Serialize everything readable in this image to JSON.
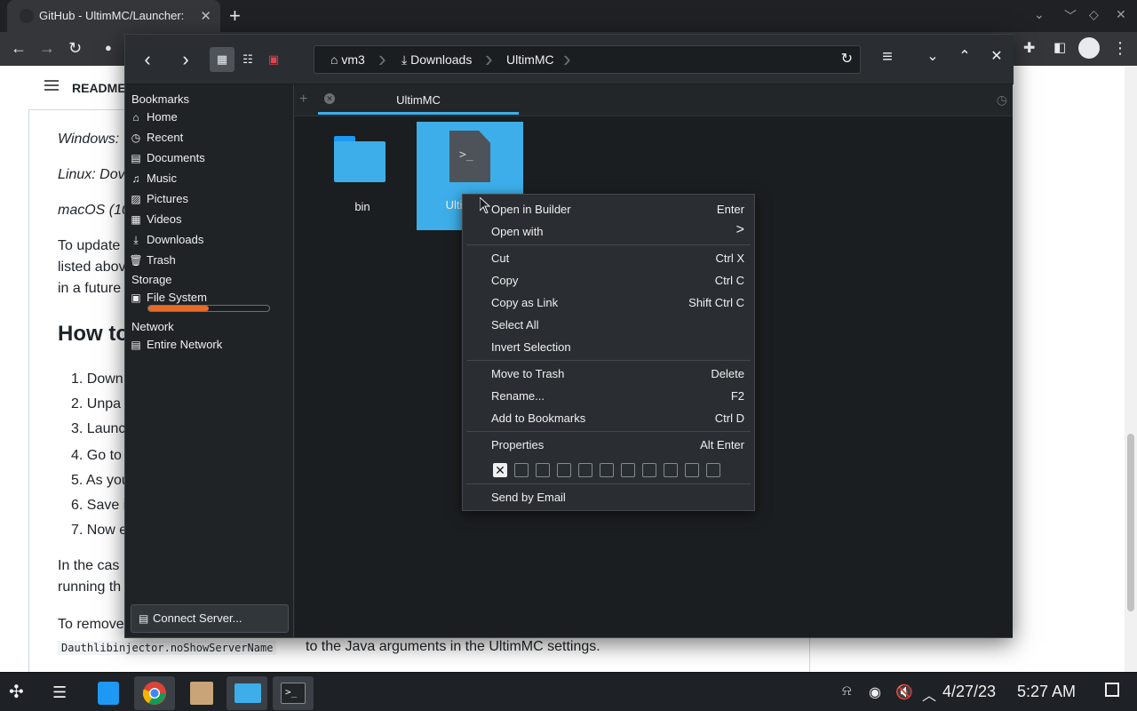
{
  "browser": {
    "tab_title": "GitHub - UltimMC/Launcher:",
    "tab_close": "✕",
    "new_tab": "+",
    "readme_label": "README"
  },
  "page_text": {
    "windows": "Windows:",
    "linux": "Linux: Dov",
    "macos": "macOS (10",
    "update_1": "To update",
    "update_2": "listed abov",
    "update_3": "in a future",
    "heading": "How to",
    "steps": [
      "1. Down",
      "2. Unpa",
      "3. Launc",
      "4. Go to",
      "5. As you",
      "6. Save i",
      "7. Now e"
    ],
    "case_1": "In the cas",
    "case_2": "running th",
    "remove": "To remove",
    "code": "Dauthlibinjector.noShowServerName",
    "tail": " to the Java arguments in the UltimMC settings."
  },
  "dolphin": {
    "breadcrumb": [
      {
        "label": "vm3",
        "icon": "home-icon"
      },
      {
        "label": "Downloads",
        "icon": "download-icon"
      },
      {
        "label": "UltimMC",
        "icon": ""
      }
    ],
    "places": {
      "bookmarks_header": "Bookmarks",
      "bookmarks": [
        {
          "label": "Home",
          "icon": "⌂"
        },
        {
          "label": "Recent",
          "icon": "◷"
        },
        {
          "label": "Documents",
          "icon": "▤"
        },
        {
          "label": "Music",
          "icon": "♫"
        },
        {
          "label": "Pictures",
          "icon": "▨"
        },
        {
          "label": "Videos",
          "icon": "▦"
        },
        {
          "label": "Downloads",
          "icon": "⤓"
        },
        {
          "label": "Trash",
          "icon": "🗑"
        }
      ],
      "storage_header": "Storage",
      "storage": [
        {
          "label": "File System",
          "icon": "▣"
        }
      ],
      "filesystem_usage_percent": 50,
      "network_header": "Network",
      "network": [
        {
          "label": "Entire Network",
          "icon": "▤"
        }
      ],
      "connect_button": "Connect Server..."
    },
    "tab_label": "UltimMC",
    "files": [
      {
        "label": "bin",
        "type": "folder",
        "selected": false
      },
      {
        "label": "Ulti",
        "type": "script",
        "selected": true
      }
    ]
  },
  "context_menu": {
    "items": [
      {
        "label": "Open in Builder",
        "shortcut": "Enter"
      },
      {
        "label": "Open with",
        "shortcut": ">"
      },
      {
        "label": "Cut",
        "shortcut": "Ctrl X"
      },
      {
        "label": "Copy",
        "shortcut": "Ctrl C"
      },
      {
        "label": "Copy as Link",
        "shortcut": "Shift Ctrl C"
      },
      {
        "label": "Select All",
        "shortcut": ""
      },
      {
        "label": "Invert Selection",
        "shortcut": ""
      },
      {
        "label": "Move to Trash",
        "shortcut": "Delete"
      },
      {
        "label": "Rename...",
        "shortcut": "F2"
      },
      {
        "label": "Add to Bookmarks",
        "shortcut": "Ctrl D"
      },
      {
        "label": "Properties",
        "shortcut": "Alt Enter"
      },
      {
        "label": "Send by Email",
        "shortcut": ""
      }
    ],
    "clear_tag": "✕"
  },
  "taskbar": {
    "date": "4/27/23",
    "time": "5:27 AM"
  },
  "colors": {
    "accent": "#3daee9",
    "dolphin_bg": "#1b1e20",
    "menu_bg": "#2a2e32"
  }
}
